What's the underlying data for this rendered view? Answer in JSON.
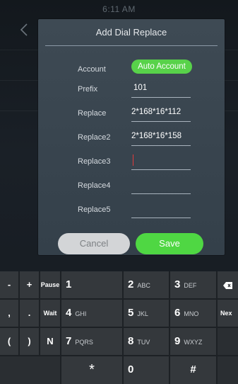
{
  "statusbar": {
    "time": "6:11 AM"
  },
  "dialog": {
    "title": "Add Dial Replace",
    "fields": [
      {
        "label": "Account",
        "value": "Auto Account"
      },
      {
        "label": "Prefix",
        "value": "101"
      },
      {
        "label": "Replace",
        "value": "2*168*16*112"
      },
      {
        "label": "Replace2",
        "value": "2*168*16*158"
      },
      {
        "label": "Replace3",
        "value": ""
      },
      {
        "label": "Replace4",
        "value": ""
      },
      {
        "label": "Replace5",
        "value": ""
      }
    ],
    "cancel_label": "Cancel",
    "save_label": "Save"
  },
  "keyboard": {
    "rows": [
      [
        {
          "main": "-"
        },
        {
          "main": "+"
        },
        {
          "main": "Pause"
        },
        {
          "main": "1",
          "sub": ""
        },
        {
          "main": "2",
          "sub": "ABC"
        },
        {
          "main": "3",
          "sub": "DEF"
        },
        {
          "icon": "backspace-icon"
        }
      ],
      [
        {
          "main": ","
        },
        {
          "main": "."
        },
        {
          "main": "Wait"
        },
        {
          "main": "4",
          "sub": "GHI"
        },
        {
          "main": "5",
          "sub": "JKL"
        },
        {
          "main": "6",
          "sub": "MNO"
        },
        {
          "main": "Nex"
        }
      ],
      [
        {
          "main": "("
        },
        {
          "main": ")"
        },
        {
          "main": "N"
        },
        {
          "main": "7",
          "sub": "PQRS"
        },
        {
          "main": "8",
          "sub": "TUV"
        },
        {
          "main": "9",
          "sub": "WXYZ"
        }
      ],
      [
        {
          "main": "*"
        },
        {
          "main": "0"
        },
        {
          "main": "#"
        }
      ]
    ]
  },
  "colors": {
    "accent_green": "#4fd743",
    "cursor_red": "#e23b3b",
    "dialog_bg": "#3a4650"
  }
}
